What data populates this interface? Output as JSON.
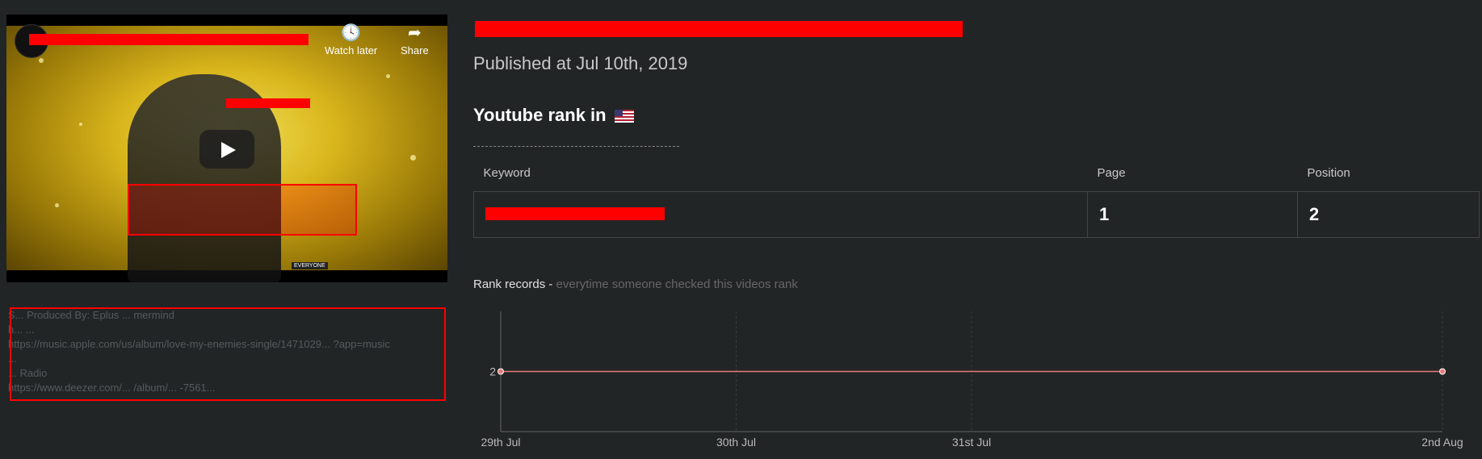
{
  "video": {
    "buttons": {
      "watch_later": "Watch later",
      "share": "Share"
    },
    "rating": "EVERYONE"
  },
  "description": {
    "text": "S... Produced By: Eplus ... mermind\nh... ...\nhttps://music.apple.com/us/album/love-my-enemies-single/1471029... ?app=music\n...\n... Radio\nhttps://www.deezer.com/... /album/... -7561..."
  },
  "published": "Published at Jul 10th, 2019",
  "rank_heading": "Youtube rank in",
  "table": {
    "headers": [
      "Keyword",
      "Page",
      "Position"
    ],
    "rows": [
      {
        "keyword": "",
        "page": "1",
        "position": "2"
      }
    ]
  },
  "records": {
    "label": "Rank records -",
    "sub": " everytime someone checked this videos rank"
  },
  "chart_data": {
    "type": "line",
    "x": [
      "29th Jul",
      "2nd Aug"
    ],
    "x_ticks": [
      "29th Jul",
      "30th Jul",
      "31st Jul",
      "2nd Aug"
    ],
    "series": [
      {
        "values": [
          2,
          2
        ]
      }
    ],
    "y_ticks": [
      2
    ],
    "grid": true,
    "color": "#e87a7a"
  }
}
